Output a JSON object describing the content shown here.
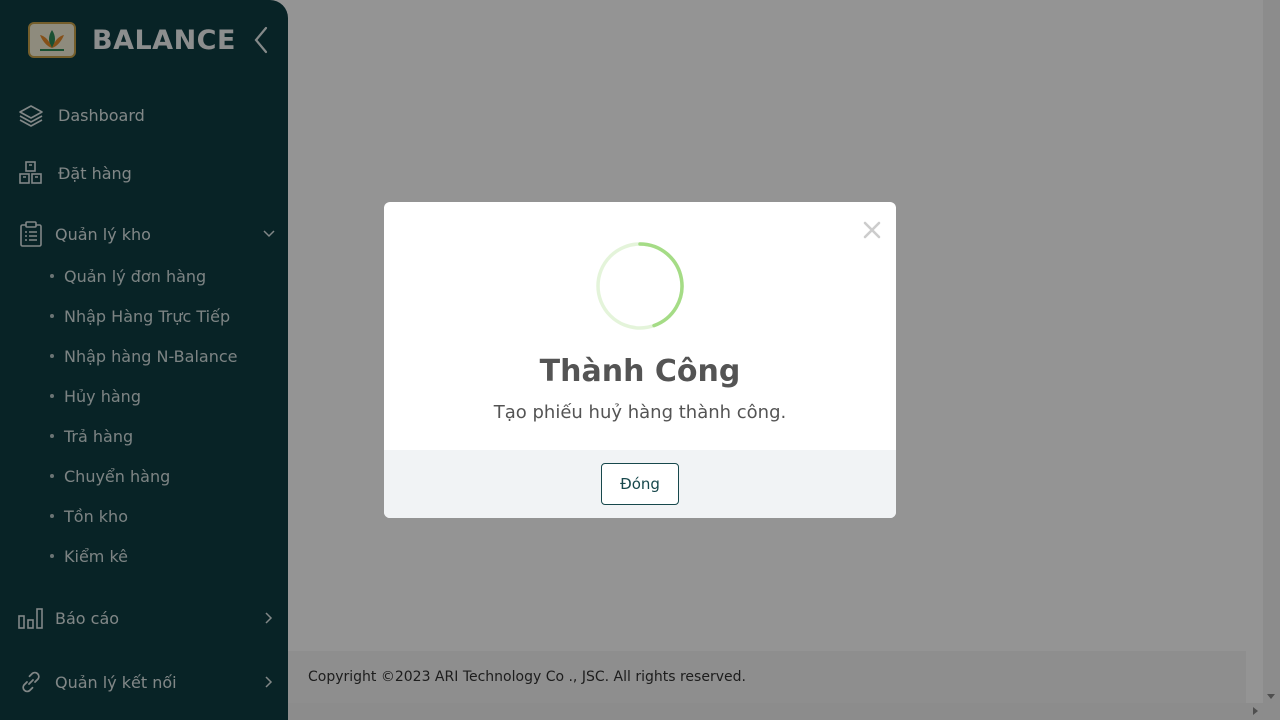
{
  "app": {
    "brand_name": "BALANCE",
    "logo_icon": "lotus-logo",
    "collapse_icon": "chevron-left-icon"
  },
  "sidebar": {
    "items": [
      {
        "label": "Dashboard",
        "icon": "layers-icon"
      },
      {
        "label": "Đặt hàng",
        "icon": "boxes-icon"
      },
      {
        "label": "Quản lý kho",
        "icon": "clipboard-icon",
        "expanded": true,
        "children": [
          "Quản lý đơn hàng",
          "Nhập Hàng Trực Tiếp",
          "Nhập hàng N-Balance",
          "Hủy hàng",
          "Trả hàng",
          "Chuyển hàng",
          "Tồn kho",
          "Kiểm kê"
        ]
      },
      {
        "label": "Báo cáo",
        "icon": "bar-chart-icon"
      },
      {
        "label": "Quản lý kết nối",
        "icon": "link-icon"
      }
    ]
  },
  "footer": {
    "copyright": "Copyright ©2023 ARI Technology Co ., JSC. All rights reserved."
  },
  "modal": {
    "title": "Thành Công",
    "message": "Tạo phiếu huỷ hàng thành công.",
    "button_label": "Đóng",
    "spinner_color": "#a5dc86"
  },
  "colors": {
    "sidebar_bg": "#0e3d42",
    "accent": "#17484c"
  }
}
